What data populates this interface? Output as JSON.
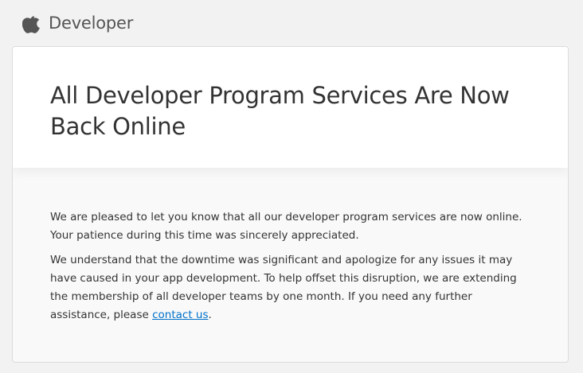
{
  "header": {
    "brand_label": "Developer",
    "logo_icon": "apple-logo-icon"
  },
  "notice": {
    "title": "All Developer Program Services Are Now Back Online",
    "paragraph_1": "We are pleased to let you know that all our developer program services are now online. Your patience during this time was sincerely appreciated.",
    "paragraph_2_text": "We understand that the downtime was significant and apologize for any issues it may have caused in your app development. To help offset this disruption, we are extending the membership of all developer teams by one month. If you need any further assistance, please ",
    "contact_link_label": "contact us",
    "paragraph_2_end": "."
  },
  "colors": {
    "background": "#f2f2f2",
    "card": "#f9f9f9",
    "link": "#0070c9",
    "text": "#333333"
  }
}
